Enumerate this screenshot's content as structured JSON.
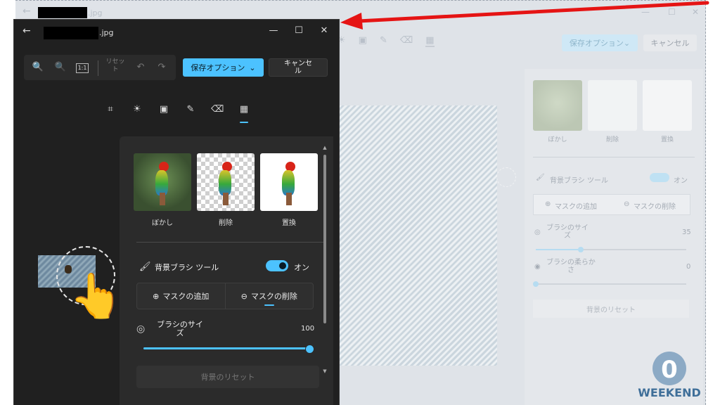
{
  "file_name_suffix": ".jpg",
  "toolbar": {
    "reset_label": "リセット",
    "save_label": "保存オプション",
    "cancel_label": "キャンセル"
  },
  "icons": {
    "back": "←",
    "minimize": "—",
    "maximize": "☐",
    "close": "✕",
    "zoom_in": "🔍",
    "zoom_out": "🔍",
    "actual_size": "1:1",
    "undo": "↶",
    "redo": "↷",
    "chevron_down": "⌄",
    "crop": "⌗",
    "adjust": "☀",
    "filter": "▣",
    "markup": "✎",
    "erase": "⌫",
    "background": "▦",
    "brush": "🖌",
    "plus_circle": "⊕",
    "minus_circle": "⊖",
    "size": "◎",
    "softness": "◉",
    "pointing_hand": "👆"
  },
  "background_options": [
    {
      "label": "ぼかし"
    },
    {
      "label": "削除"
    },
    {
      "label": "置換"
    }
  ],
  "brush_tool": {
    "label": "背景ブラシ ツール",
    "toggle_state": "オン",
    "toggle_on": true
  },
  "mask": {
    "add_label": "マスクの追加",
    "remove_label": "マスクの削除",
    "active": "remove"
  },
  "brush_size": {
    "label": "ブラシのサイズ",
    "value": "100",
    "fraction": 1.0
  },
  "reset_background_label": "背景のリセット",
  "bg_window": {
    "brush_size_label": "ブラシのサイズ",
    "brush_size_value": "35",
    "brush_size_fraction": 0.3,
    "softness_label": "ブラシの柔らかさ",
    "softness_value": "0",
    "softness_fraction": 0.0
  },
  "logo": {
    "text": "WEEKEND",
    "numeral": "0"
  },
  "colors": {
    "accent": "#4cc2ff",
    "dark_bg": "#202020",
    "panel_bg": "#2b2b2b",
    "arrow": "#e51414"
  }
}
